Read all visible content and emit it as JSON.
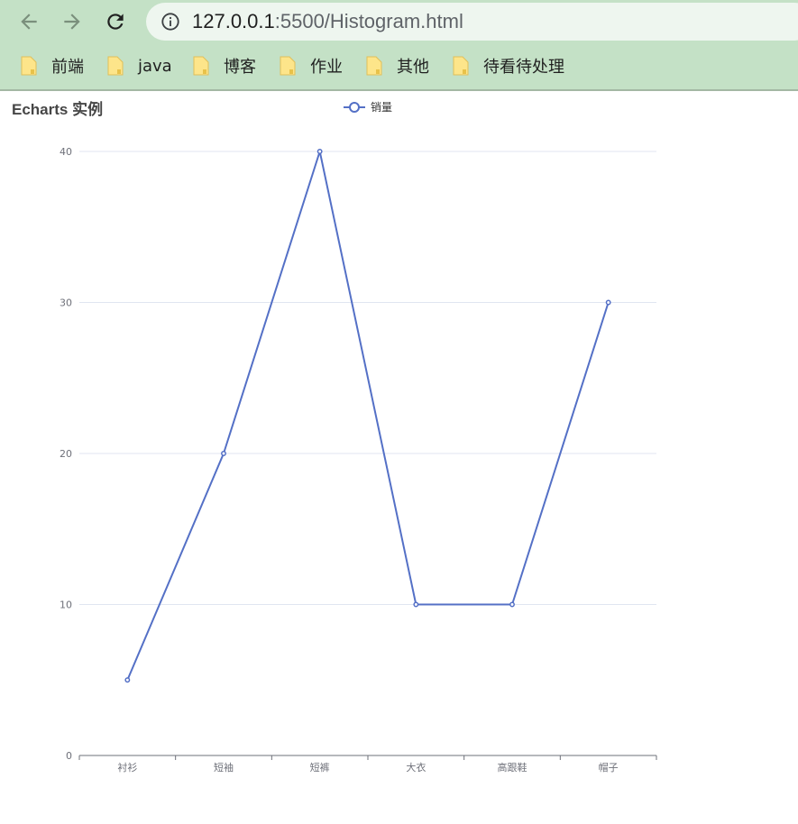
{
  "browser": {
    "url_host": "127.0.0.1",
    "url_rest": ":5500/Histogram.html",
    "bookmarks": [
      "前端",
      "java",
      "博客",
      "作业",
      "其他",
      "待看待处理"
    ]
  },
  "chart_data": {
    "type": "line",
    "title": "Echarts 实例",
    "legend": "销量",
    "legend_position": "top-center",
    "categories": [
      "衬衫",
      "短袖",
      "短裤",
      "大衣",
      "高跟鞋",
      "帽子"
    ],
    "series": [
      {
        "name": "销量",
        "values": [
          5,
          20,
          40,
          10,
          10,
          30
        ]
      }
    ],
    "ylim": [
      0,
      40
    ],
    "yticks": [
      0,
      10,
      20,
      30,
      40
    ],
    "grid": true,
    "colors": {
      "line": "#5470c6",
      "grid": "#e0e6f1",
      "axis": "#6e7079",
      "title": "#464646"
    }
  }
}
